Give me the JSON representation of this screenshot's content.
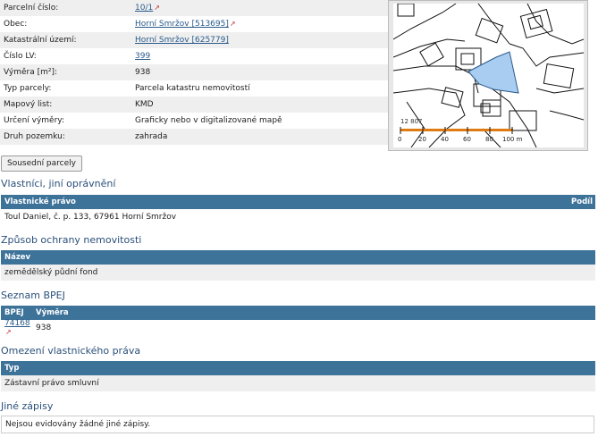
{
  "props": [
    {
      "key": "Parcelní číslo",
      "value": "10/1",
      "link": true,
      "ext": true
    },
    {
      "key": "Obec",
      "value": "Horní Smržov [513695]",
      "link": true,
      "ext": true
    },
    {
      "key": "Katastrální území",
      "value": "Horní Smržov [625779]",
      "link": true,
      "ext": false
    },
    {
      "key": "Číslo LV",
      "value": "399",
      "link": true,
      "ext": false
    },
    {
      "key": "Výměra [m²]",
      "value": "938",
      "link": false,
      "ext": false
    },
    {
      "key": "Typ parcely",
      "value": "Parcela katastru nemovitostí",
      "link": false,
      "ext": false
    },
    {
      "key": "Mapový list",
      "value": "KMD",
      "link": false,
      "ext": false
    },
    {
      "key": "Určení výměry",
      "value": "Graficky nebo v digitalizované mapě",
      "link": false,
      "ext": false
    },
    {
      "key": "Druh pozemku",
      "value": "zahrada",
      "link": false,
      "ext": false
    }
  ],
  "map": {
    "label": "12 807",
    "scale_ticks": [
      "0",
      "20",
      "40",
      "60",
      "80",
      "100 m"
    ],
    "parcel_color": "#a9cdf1",
    "scale_color": "#e07a12"
  },
  "neighbors_button": "Sousední parcely",
  "owners": {
    "title": "Vlastníci, jiní oprávnění",
    "col_right": "Vlastnické právo",
    "col_share": "Podíl",
    "row": "Toul Daniel, č. p. 133, 67961 Horní Smržov"
  },
  "protection": {
    "title": "Způsob ochrany nemovitosti",
    "col": "Název",
    "row": "zemědělský půdní fond"
  },
  "bpej": {
    "title": "Seznam BPEJ",
    "col_code": "BPEJ",
    "col_area": "Výměra",
    "code": "74168",
    "area": "938"
  },
  "restrictions": {
    "title": "Omezení vlastnického práva",
    "col": "Typ",
    "row": "Zástavní právo smluvní"
  },
  "other": {
    "title": "Jiné zápisy",
    "text": "Nejsou evidovány žádné jiné zápisy."
  }
}
